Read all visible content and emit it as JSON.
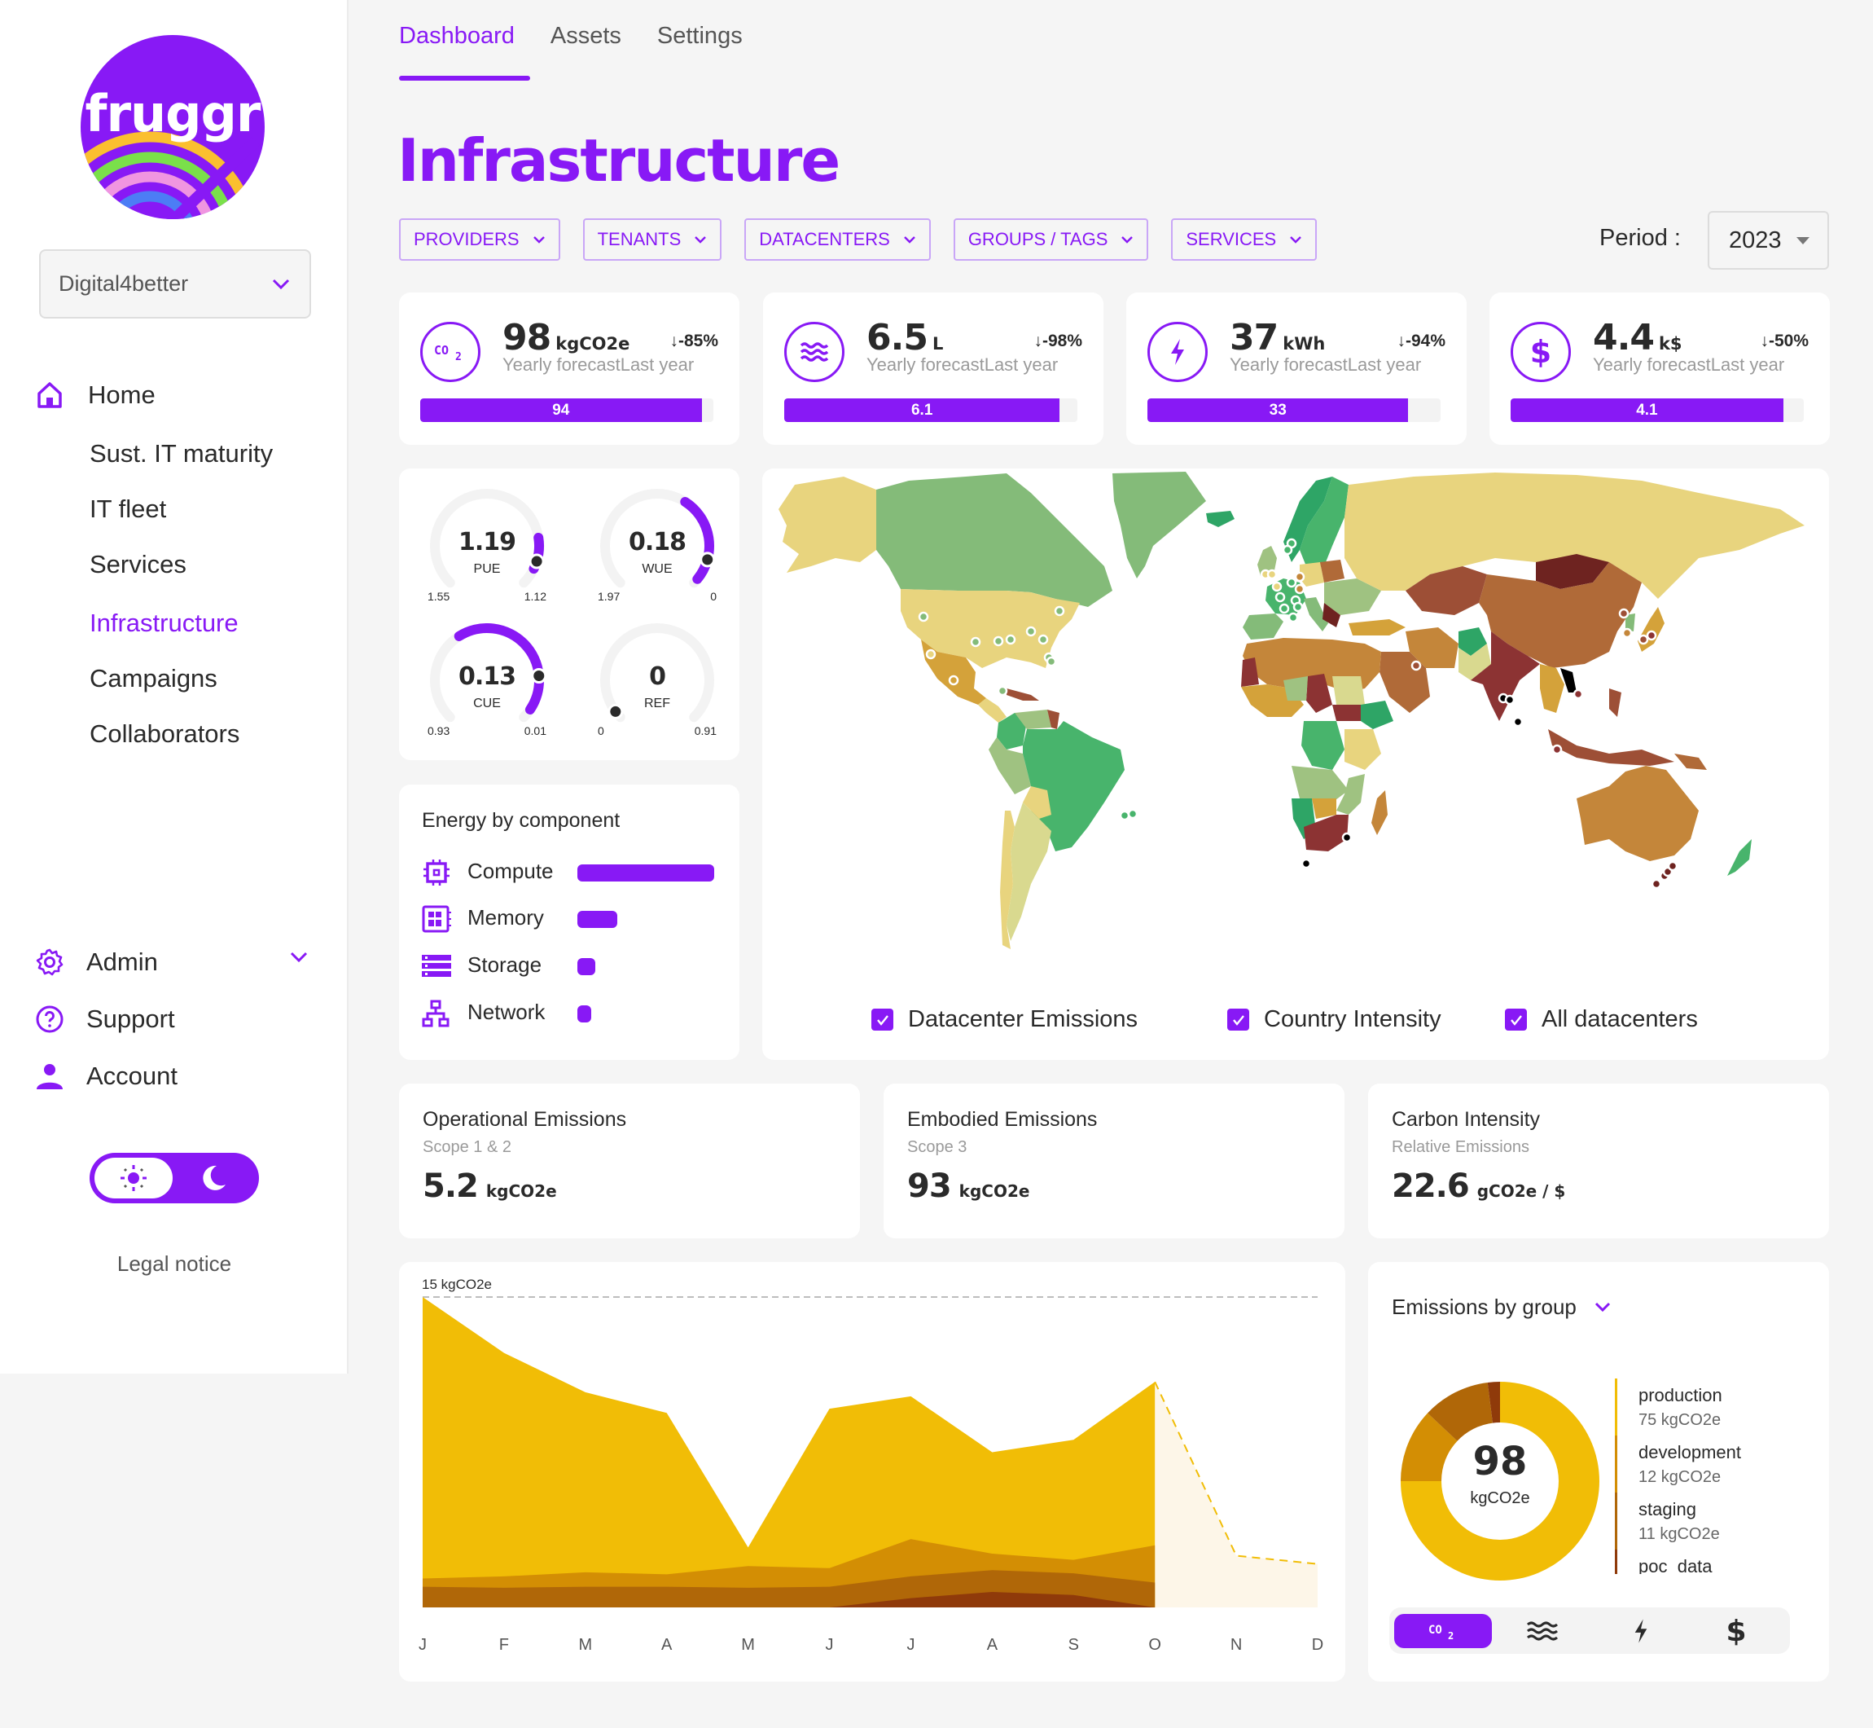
{
  "brand": {
    "name": "fruggr",
    "accent": "#8819f5"
  },
  "sidebar": {
    "organization": "Digital4better",
    "nav": [
      {
        "label": "Home",
        "icon": "home-icon",
        "active": false
      },
      {
        "label": "Sust. IT maturity",
        "active": false
      },
      {
        "label": "IT fleet",
        "active": false
      },
      {
        "label": "Services",
        "active": false
      },
      {
        "label": "Infrastructure",
        "active": true
      },
      {
        "label": "Campaigns",
        "active": false
      },
      {
        "label": "Collaborators",
        "active": false
      }
    ],
    "bottom_nav": [
      {
        "label": "Admin",
        "icon": "gear-icon"
      },
      {
        "label": "Support",
        "icon": "help-icon"
      },
      {
        "label": "Account",
        "icon": "user-icon"
      }
    ],
    "theme": "light",
    "legal_notice": "Legal notice"
  },
  "header": {
    "tabs": [
      {
        "label": "Dashboard",
        "active": true
      },
      {
        "label": "Assets",
        "active": false
      },
      {
        "label": "Settings",
        "active": false
      }
    ],
    "title": "Infrastructure",
    "filters": [
      "PROVIDERS",
      "TENANTS",
      "DATACENTERS",
      "GROUPS / TAGS",
      "SERVICES"
    ],
    "period_label": "Period :",
    "period_value": "2023"
  },
  "kpis": [
    {
      "icon": "co2-icon",
      "value": "98",
      "unit": "kgCO2e",
      "delta": "-85%",
      "sublabel": "Yearly forecastLast year",
      "last_year": "94",
      "last_year_fraction": 0.96
    },
    {
      "icon": "water-icon",
      "value": "6.5",
      "unit": "L",
      "delta": "-98%",
      "sublabel": "Yearly forecastLast year",
      "last_year": "6.1",
      "last_year_fraction": 0.94
    },
    {
      "icon": "energy-icon",
      "value": "37",
      "unit": "kWh",
      "delta": "-94%",
      "sublabel": "Yearly forecastLast year",
      "last_year": "33",
      "last_year_fraction": 0.89
    },
    {
      "icon": "dollar-icon",
      "value": "4.4",
      "unit": "k$",
      "delta": "-50%",
      "sublabel": "Yearly forecastLast year",
      "last_year": "4.1",
      "last_year_fraction": 0.93
    }
  ],
  "gauges": [
    {
      "name": "PUE",
      "value": "1.19",
      "min": "1.55",
      "max": "1.12",
      "fill_from": 0.8,
      "fill_to": 0.93
    },
    {
      "name": "WUE",
      "value": "0.18",
      "min": "1.97",
      "max": "0",
      "fill_from": 0.62,
      "fill_to": 0.98
    },
    {
      "name": "CUE",
      "value": "0.13",
      "min": "0.93",
      "max": "0.01",
      "fill_from": 0.38,
      "fill_to": 0.96
    },
    {
      "name": "REF",
      "value": "0",
      "min": "0",
      "max": "0.91",
      "fill_from": 0.0,
      "fill_to": 0.0
    }
  ],
  "energy_by_component": {
    "title": "Energy by component",
    "items": [
      {
        "label": "Compute",
        "icon": "cpu-icon",
        "share": 1.0
      },
      {
        "label": "Memory",
        "icon": "memory-icon",
        "share": 0.29
      },
      {
        "label": "Storage",
        "icon": "storage-icon",
        "share": 0.13
      },
      {
        "label": "Network",
        "icon": "network-icon",
        "share": 0.1
      }
    ]
  },
  "map": {
    "legend": [
      {
        "label": "Datacenter Emissions",
        "checked": true
      },
      {
        "label": "Country Intensity",
        "checked": true
      },
      {
        "label": "All datacenters",
        "checked": true
      }
    ],
    "color_scale": [
      "#2ea566",
      "#48b46c",
      "#84bb79",
      "#9fc281",
      "#d9d98f",
      "#e8d47e",
      "#d4a23a",
      "#c4863a",
      "#b06a38",
      "#9d4f36",
      "#8c3333",
      "#6e2320",
      "#000000"
    ]
  },
  "summary": [
    {
      "title": "Operational Emissions",
      "subtitle": "Scope 1 & 2",
      "value": "5.2",
      "unit": "kgCO2e"
    },
    {
      "title": "Embodied Emissions",
      "subtitle": "Scope 3",
      "value": "93",
      "unit": "kgCO2e"
    },
    {
      "title": "Carbon Intensity",
      "subtitle": "Relative Emissions",
      "value": "22.6",
      "unit": "gCO2e / $"
    }
  ],
  "chart_data": [
    {
      "type": "area",
      "title": "",
      "stacked": true,
      "ylabel": "kgCO2e",
      "max_label": "15 kgCO2e",
      "ylim": [
        0,
        15
      ],
      "categories": [
        "J",
        "F",
        "M",
        "A",
        "M",
        "J",
        "J",
        "A",
        "S",
        "O",
        "N",
        "D"
      ],
      "actual_months": 10,
      "series": [
        {
          "name": "poc_data",
          "color": "#8f3a0a",
          "values": [
            0,
            0,
            0,
            0,
            0,
            0,
            0.45,
            0.75,
            0.6,
            0
          ]
        },
        {
          "name": "staging",
          "color": "#b06708",
          "values": [
            1.0,
            0.95,
            1.0,
            1.0,
            0.95,
            1.0,
            1.05,
            1.05,
            1.05,
            1.2
          ]
        },
        {
          "name": "development",
          "color": "#d38e04",
          "values": [
            0.4,
            0.55,
            0.7,
            0.6,
            1.05,
            0.9,
            1.8,
            0.8,
            0.65,
            1.8
          ]
        },
        {
          "name": "production",
          "color": "#f1bd06",
          "values": [
            13.6,
            10.8,
            8.7,
            7.8,
            0.9,
            7.7,
            6.9,
            4.9,
            5.8,
            7.9
          ]
        }
      ],
      "forecast": {
        "months": [
          "O",
          "N",
          "D"
        ],
        "values": [
          10.9,
          2.5,
          2.1
        ],
        "color": "#f1bd06",
        "fill": "#fdf6e8"
      }
    },
    {
      "type": "pie",
      "title": "Emissions by group",
      "center_value": "98",
      "center_unit": "kgCO2e",
      "categories": [
        "production",
        "development",
        "staging",
        "poc_data"
      ],
      "values": [
        75,
        12,
        11,
        2
      ],
      "value_labels": [
        "75 kgCO2e",
        "12 kgCO2e",
        "11 kgCO2e",
        ""
      ],
      "legend_labels": [
        "production",
        "development",
        "staging",
        "poc_data"
      ],
      "colors": [
        "#f1bd06",
        "#d38e04",
        "#b06708",
        "#8f3a0a"
      ]
    }
  ],
  "metric_switch": [
    {
      "icon": "co2-icon",
      "active": true
    },
    {
      "icon": "water-icon",
      "active": false
    },
    {
      "icon": "energy-icon",
      "active": false
    },
    {
      "icon": "dollar-icon",
      "active": false
    }
  ]
}
